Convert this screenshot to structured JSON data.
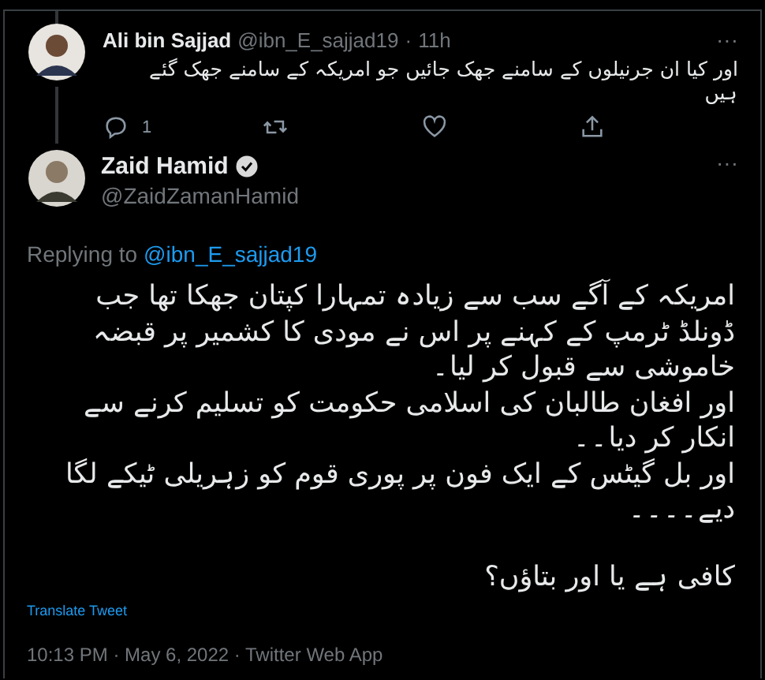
{
  "parent_tweet": {
    "name": "Ali bin Sajjad",
    "handle": "@ibn_E_sajjad19",
    "separator": "·",
    "time": "11h",
    "text": "اور کیا ان جرنیلوں کے سامنے جھک جائیں جو امریکہ کے سامنے جھک گئے ہیں",
    "more": "···",
    "actions": [
      {
        "kind": "reply",
        "count": "1"
      },
      {
        "kind": "retweet"
      },
      {
        "kind": "like"
      },
      {
        "kind": "share"
      }
    ]
  },
  "main_tweet": {
    "name": "Zaid Hamid",
    "verified": true,
    "handle": "@ZaidZamanHamid",
    "more": "···",
    "replying_label": "Replying to",
    "replying_handle": "@ibn_E_sajjad19",
    "paragraphs": [
      "امریکہ کے آگے سب سے زیادہ تمہارا کپتان جھکا تھا جب ڈونلڈ ٹرمپ کے کہنے پر اس نے مودی کا کشمیر پر قبضہ خاموشی سے قبول کر لیا۔",
      "اور افغان طالبان کی اسلامی حکومت کو تسلیم کرنے سے انکار کر دیا۔۔",
      "اور بل گیٹس کے ایک فون پر پوری قوم کو زہریلی ٹیکے لگا دیے۔۔۔۔",
      "کافی ہے یا اور بتاؤں؟"
    ],
    "translate": "Translate Tweet",
    "timestamp": "10:13 PM · May 6, 2022 · Twitter Web App"
  }
}
